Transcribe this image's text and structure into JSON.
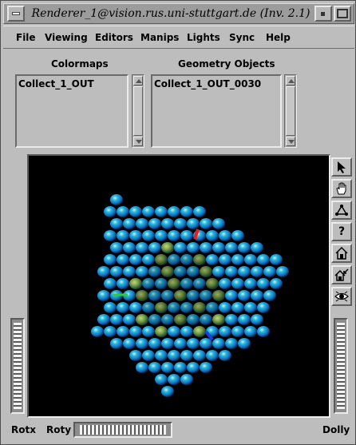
{
  "window": {
    "title": "Renderer_1@vision.rus.uni-stuttgart.de (Inv. 2.1)"
  },
  "menu": {
    "items": [
      "File",
      "Viewing",
      "Editors",
      "Manips",
      "Lights",
      "Sync",
      "Help"
    ]
  },
  "colormaps": {
    "label": "Colormaps",
    "items": [
      "Collect_1_OUT"
    ]
  },
  "geometry_objects": {
    "label": "Geometry Objects",
    "items": [
      "Collect_1_OUT_0030"
    ]
  },
  "viewer": {
    "background": "#000000",
    "object_colors": [
      "#27c6ee",
      "#1a6fc4",
      "#7fa84a"
    ],
    "axis_colors": {
      "x": "#2ec83a",
      "y": "#e81e1e",
      "z": "#1a3fe0"
    }
  },
  "tools": [
    {
      "name": "pick-arrow-icon",
      "label": ""
    },
    {
      "name": "view-hand-icon",
      "label": ""
    },
    {
      "name": "seek-icon",
      "label": ""
    },
    {
      "name": "help-icon",
      "label": "?"
    },
    {
      "name": "home-icon",
      "label": ""
    },
    {
      "name": "set-home-icon",
      "label": ""
    },
    {
      "name": "view-all-icon",
      "label": ""
    }
  ],
  "thumbwheels": {
    "rotx": "Rotx",
    "roty": "Roty",
    "dolly": "Dolly"
  }
}
